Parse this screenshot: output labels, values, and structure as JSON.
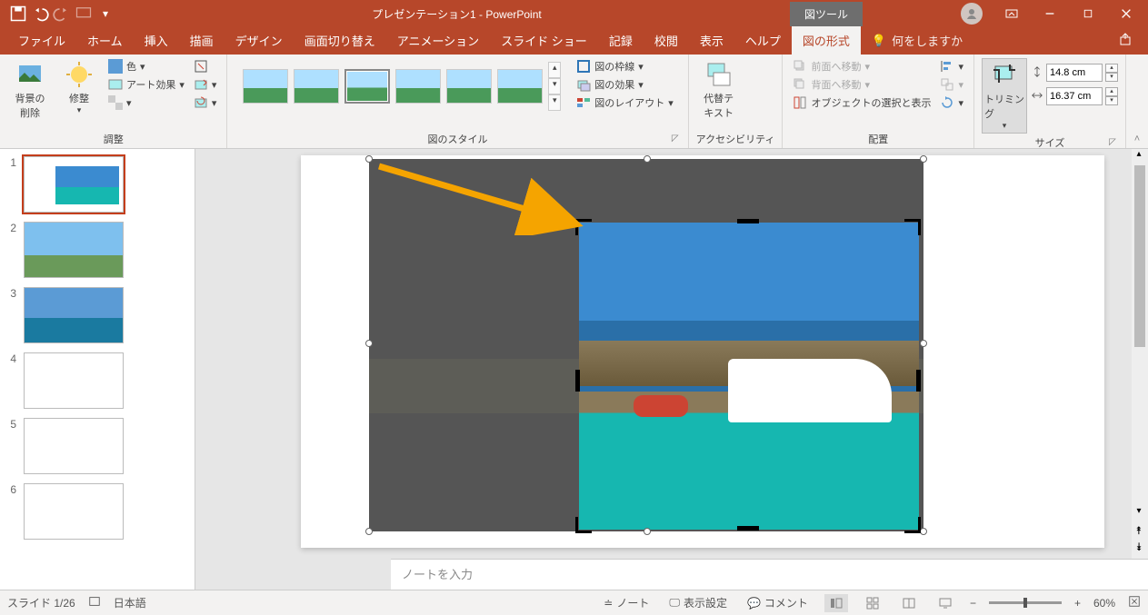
{
  "titlebar": {
    "doc_title": "プレゼンテーション1 - PowerPoint",
    "contextual_tab": "図ツール"
  },
  "tabs": {
    "file": "ファイル",
    "home": "ホーム",
    "insert": "挿入",
    "draw": "描画",
    "design": "デザイン",
    "transitions": "画面切り替え",
    "animations": "アニメーション",
    "slideshow": "スライド ショー",
    "record": "記録",
    "review": "校閲",
    "view": "表示",
    "help": "ヘルプ",
    "picture_format": "図の形式",
    "tellme": "何をしますか"
  },
  "ribbon": {
    "remove_bg": "背景の\n削除",
    "corrections": "修整",
    "color": "色",
    "artistic": "アート効果",
    "adjust_group": "調整",
    "styles_group": "図のスタイル",
    "border": "図の枠線",
    "effects": "図の効果",
    "layout": "図のレイアウト",
    "alt_text": "代替テ\nキスト",
    "accessibility_group": "アクセシビリティ",
    "bring_fwd": "前面へ移動",
    "send_back": "背面へ移動",
    "selection_pane": "オブジェクトの選択と表示",
    "arrange_group": "配置",
    "crop": "トリミング",
    "size_group": "サイズ",
    "height_value": "14.8 cm",
    "width_value": "16.37 cm"
  },
  "thumbnails": {
    "slides": [
      {
        "num": "1"
      },
      {
        "num": "2"
      },
      {
        "num": "3"
      },
      {
        "num": "4"
      },
      {
        "num": "5"
      },
      {
        "num": "6"
      }
    ]
  },
  "notes": {
    "placeholder": "ノートを入力"
  },
  "statusbar": {
    "slide_indicator": "スライド 1/26",
    "language": "日本語",
    "notes_btn": "ノート",
    "display_settings": "表示設定",
    "comments": "コメント",
    "zoom_pct": "60%"
  }
}
